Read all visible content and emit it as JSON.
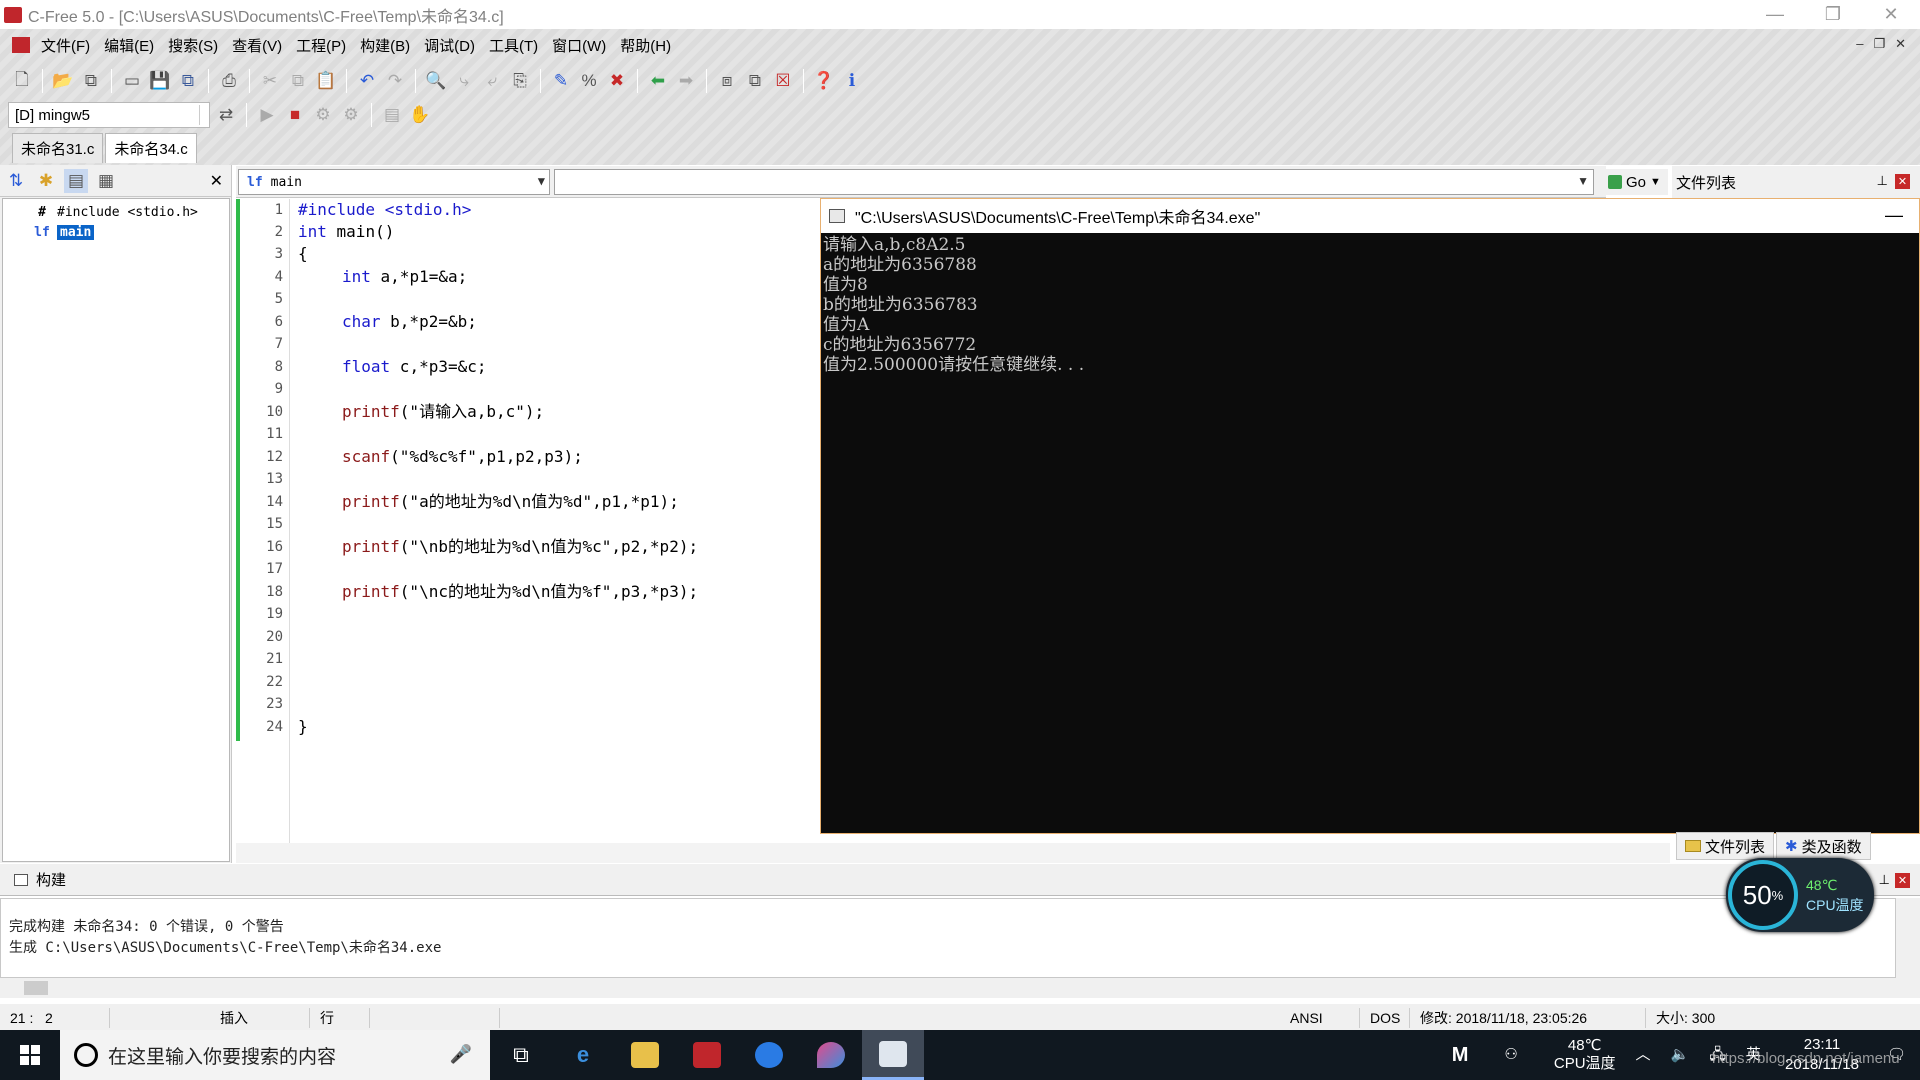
{
  "window": {
    "title": "C-Free 5.0 - [C:\\Users\\ASUS\\Documents\\C-Free\\Temp\\未命名34.c]"
  },
  "menu": [
    "文件(F)",
    "编辑(E)",
    "搜索(S)",
    "查看(V)",
    "工程(P)",
    "构建(B)",
    "调试(D)",
    "工具(T)",
    "窗口(W)",
    "帮助(H)"
  ],
  "toolbar": {
    "compiler": "[D] mingw5"
  },
  "file_tabs": [
    "未命名31.c",
    "未命名34.c"
  ],
  "symbol_tree": {
    "include": "#include <stdio.h>",
    "main": "main"
  },
  "function_combo": {
    "value": "main"
  },
  "go_button": "Go",
  "filelist": {
    "header": "文件列表"
  },
  "editor": {
    "line_numbers": [
      "1",
      "2",
      "3",
      "4",
      "5",
      "6",
      "7",
      "8",
      "9",
      "10",
      "11",
      "12",
      "13",
      "14",
      "15",
      "16",
      "17",
      "18",
      "19",
      "20",
      "21",
      "22",
      "23",
      "24"
    ],
    "lines": {
      "l1": "#include <stdio.h>",
      "l2a": "int",
      "l2b": " main()",
      "l3": "{",
      "l4a": "int",
      "l4b": " a,*p1=&a;",
      "l6a": "char",
      "l6b": " b,*p2=&b;",
      "l8a": "float",
      "l8b": " c,*p3=&c;",
      "l10a": "printf",
      "l10b": "(\"请输入a,b,c\");",
      "l12a": "scanf",
      "l12b": "(\"%d%c%f\",p1,p2,p3);",
      "l14a": "printf",
      "l14b": "(\"a的地址为%d\\n值为%d\",p1,*p1);",
      "l16a": "printf",
      "l16b": "(\"\\nb的地址为%d\\n值为%c\",p2,*p2);",
      "l18a": "printf",
      "l18b": "(\"\\nc的地址为%d\\n值为%f\",p3,*p3);",
      "l24": "}"
    }
  },
  "console": {
    "title": "\"C:\\Users\\ASUS\\Documents\\C-Free\\Temp\\未命名34.exe\"",
    "lines": [
      "请输入a,b,c8A2.5",
      "a的地址为6356788",
      "值为8",
      "b的地址为6356783",
      "值为A",
      "c的地址为6356772",
      "值为2.500000请按任意键继续. . ."
    ]
  },
  "right_tabs": [
    "文件列表",
    "类及函数"
  ],
  "build": {
    "header": "构建",
    "lines": [
      "完成构建 未命名34: 0 个错误, 0 个警告",
      "生成 C:\\Users\\ASUS\\Documents\\C-Free\\Temp\\未命名34.exe"
    ]
  },
  "statusbar": {
    "pos": "21 :   2",
    "mode": "插入",
    "row": "行",
    "encoding": "ANSI",
    "eol": "DOS",
    "modified": "修改: 2018/11/18, 23:05:26",
    "size": "大小: 300"
  },
  "cpu_widget": {
    "percent": "50",
    "unit": "%",
    "temp": "48℃",
    "label": "CPU温度"
  },
  "taskbar": {
    "search_placeholder": "在这里输入你要搜索的内容",
    "tray_temp": "48℃",
    "tray_temp_label": "CPU温度",
    "ime": "英",
    "time": "23:11",
    "date": "2018/11/18"
  },
  "watermark": "https://blog.csdn.net/jamenu",
  "colors": {
    "console_bg": "#0c0c0c",
    "keyword": "#1a1acc",
    "function": "#8b1a1a",
    "string": "#7a7a7a",
    "green_margin": "#2fbb4a"
  }
}
